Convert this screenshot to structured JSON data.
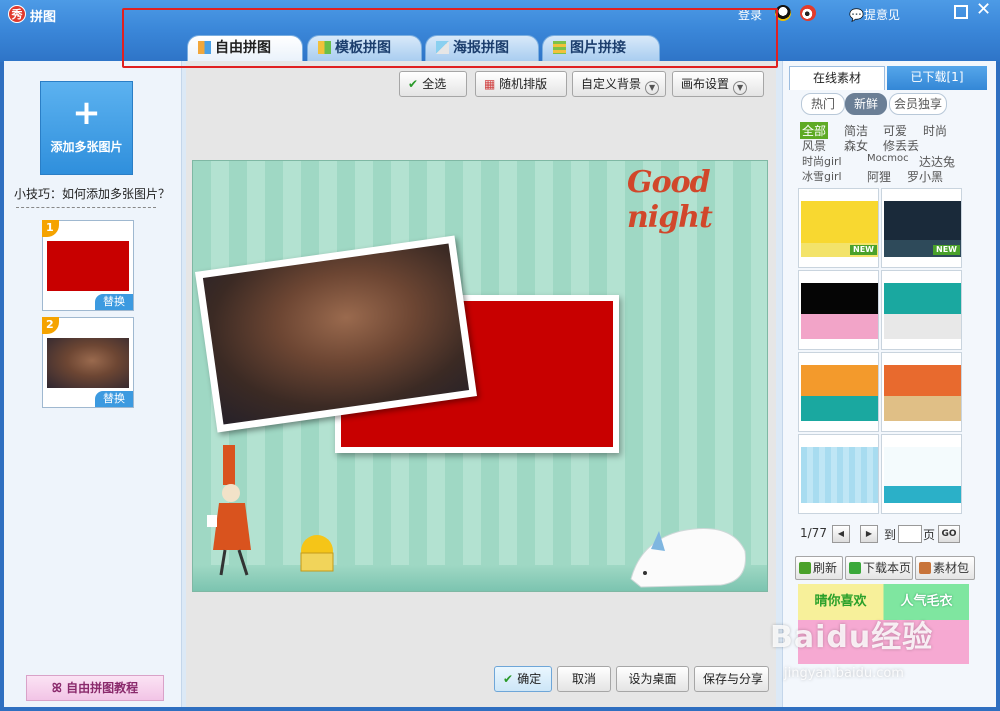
{
  "app": {
    "title": "拼图",
    "logo_char": "秀"
  },
  "titlebar": {
    "login": "登录",
    "feedback": "提意见"
  },
  "tabs": [
    {
      "label": "自由拼图",
      "icon": "free-collage-icon"
    },
    {
      "label": "模板拼图",
      "icon": "template-collage-icon"
    },
    {
      "label": "海报拼图",
      "icon": "poster-collage-icon"
    },
    {
      "label": "图片拼接",
      "icon": "image-stitch-icon"
    }
  ],
  "left": {
    "add_label": "添加多张图片",
    "tip": "小技巧：如何添加多张图片？",
    "thumbs": [
      {
        "num": "1",
        "replace": "替换"
      },
      {
        "num": "2",
        "replace": "替换"
      }
    ],
    "tutorial": "自由拼图教程"
  },
  "toolbar": {
    "select_all": "全选",
    "random": "随机排版",
    "custom_bg": "自定义背景",
    "canvas_settings": "画布设置"
  },
  "canvas": {
    "greeting": "Good night"
  },
  "bottom": {
    "confirm": "确定",
    "cancel": "取消",
    "set_desktop": "设为桌面",
    "save_share": "保存与分享"
  },
  "right": {
    "tab_online": "在线素材",
    "tab_downloaded": "已下载[1]",
    "filters": [
      "热门",
      "新鲜",
      "会员独享"
    ],
    "active_filter": "新鲜",
    "tags": [
      "全部",
      "简洁",
      "可爱",
      "时尚",
      "风景",
      "森女",
      "修丢丢",
      "时尚girl",
      "Mocmoc",
      "达达兔",
      "冰雪girl",
      "阿狸",
      "罗小黑"
    ],
    "new_badge": "NEW",
    "pager": {
      "page": "1/77",
      "to": "到",
      "page_unit": "页",
      "go": "GO"
    },
    "actions": {
      "refresh": "刷新",
      "download_page": "下载本页",
      "pack": "素材包"
    },
    "banner": {
      "left": "晴你喜欢",
      "right": "人气毛衣"
    }
  },
  "watermark": {
    "main": "Baidu经验",
    "sub": "jingyan.baidu.com"
  }
}
